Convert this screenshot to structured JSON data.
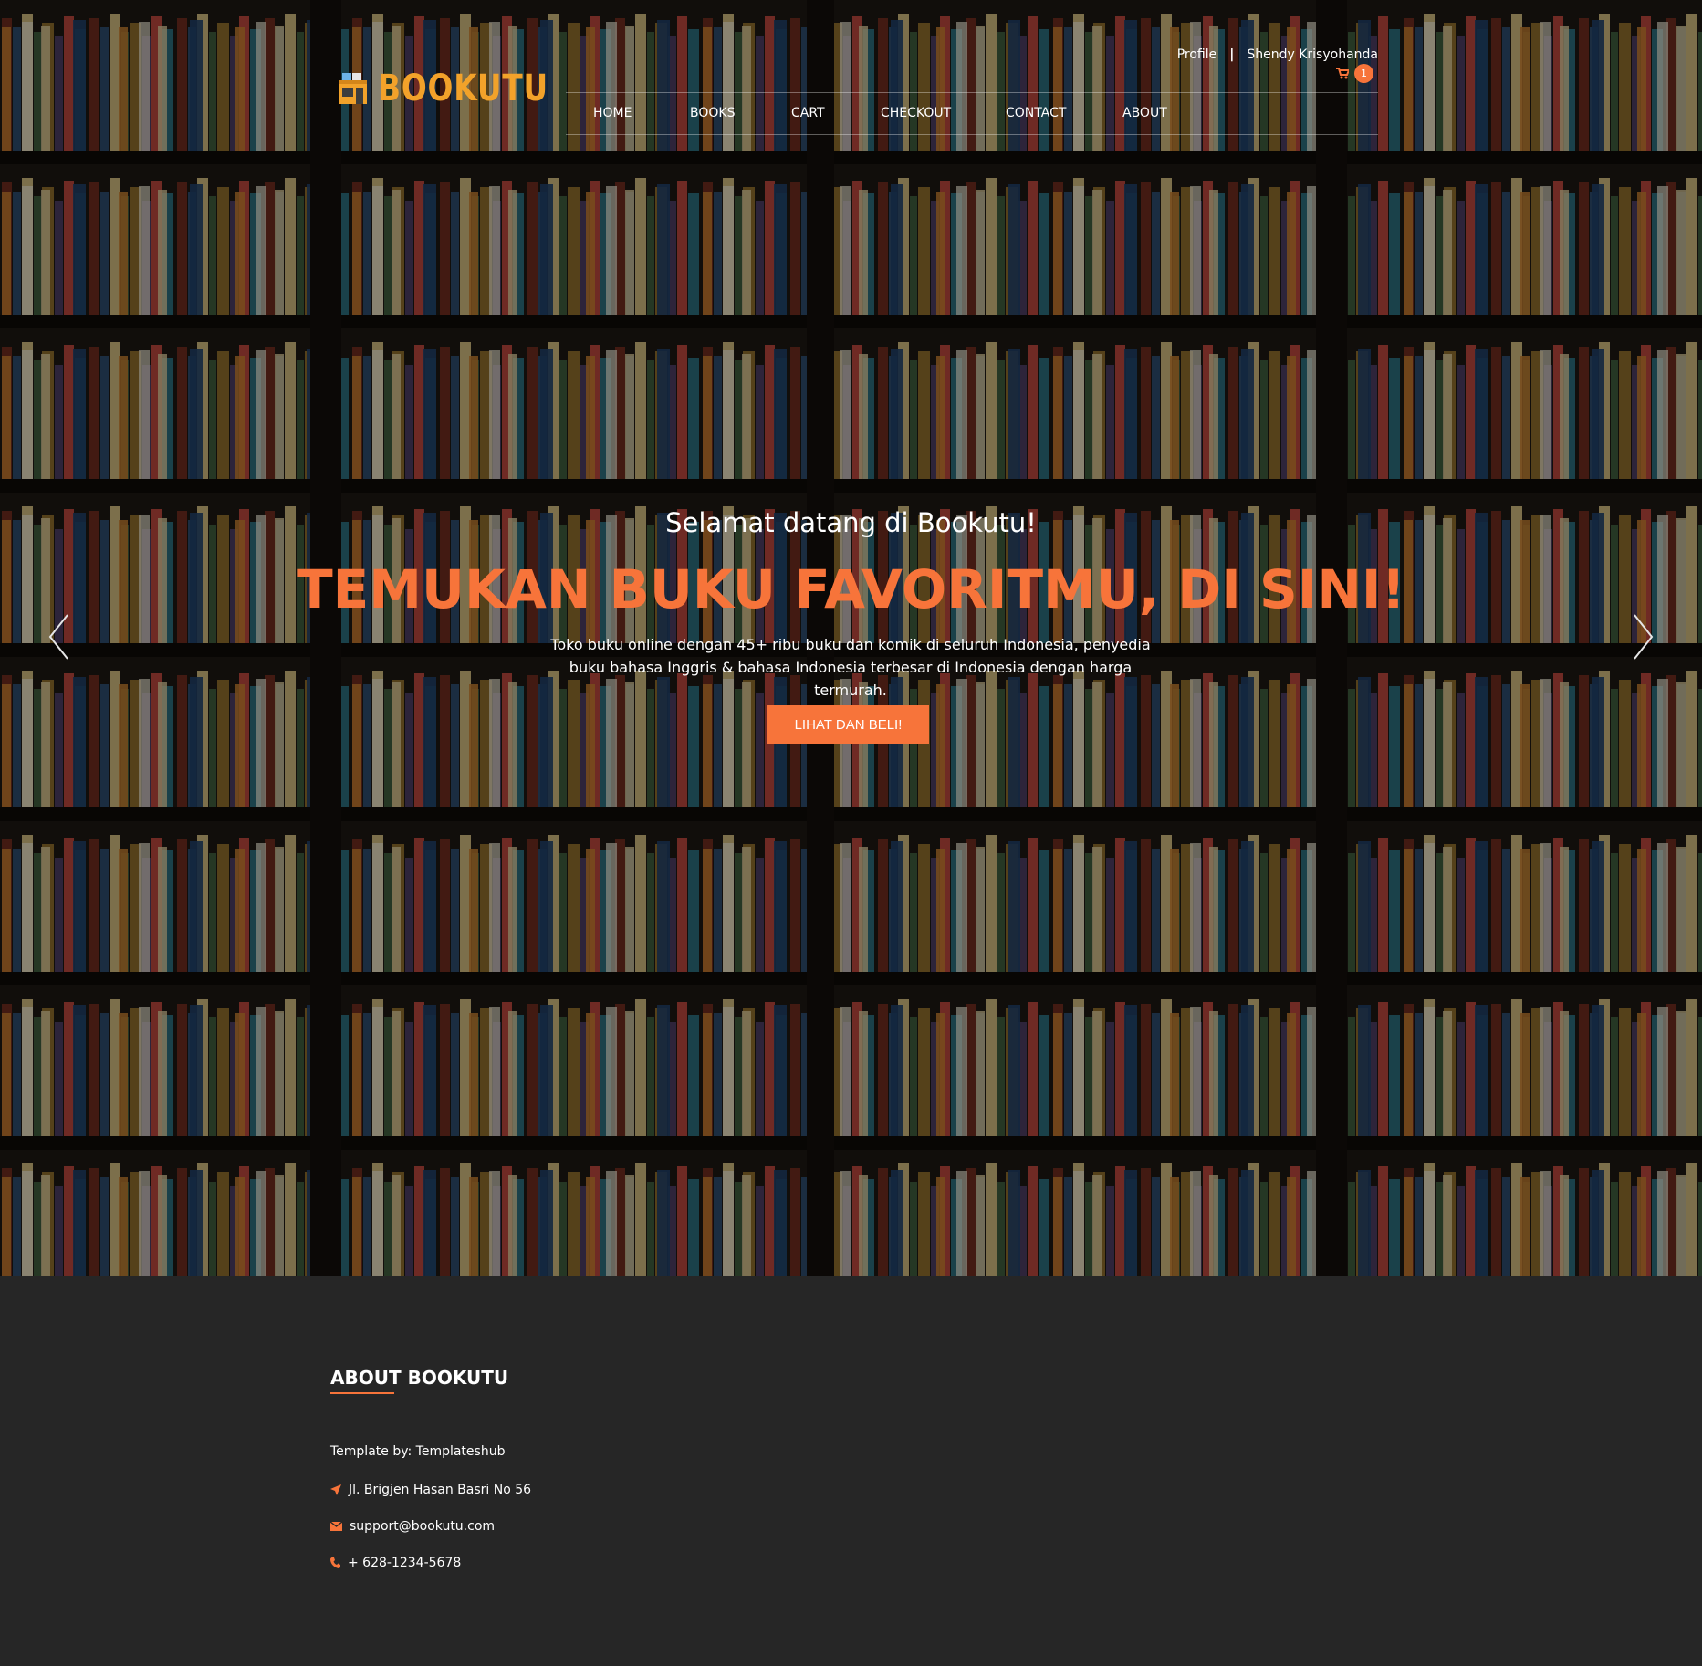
{
  "header": {
    "brand": "BOOKUTU",
    "profile_label": "Profile",
    "separator": "|",
    "user_name": "Shendy Krisyohanda",
    "cart_count": "1",
    "nav": [
      "HOME",
      "BOOKS",
      "CART",
      "CHECKOUT",
      "CONTACT",
      "ABOUT"
    ]
  },
  "hero": {
    "welcome": "Selamat datang di Bookutu!",
    "headline": "TEMUKAN BUKU FAVORITMU, DI SINI!",
    "description_line1": "Toko buku online dengan 45+ ribu buku dan komik di seluruh Indonesia, penyedia",
    "description_line2": "buku bahasa Inggris & bahasa Indonesia terbesar di Indonesia dengan harga termurah.",
    "cta_label": "LIHAT DAN BELI!"
  },
  "footer": {
    "title": "ABOUT BOOKUTU",
    "credit": "Template by: Templateshub",
    "address": "Jl. Brigjen Hasan Basri No 56",
    "email": "support@bookutu.com",
    "phone": "+ 628-1234-5678"
  },
  "colors": {
    "accent": "#f7743a",
    "brand": "#f2a22a",
    "footer_bg": "#262626"
  }
}
